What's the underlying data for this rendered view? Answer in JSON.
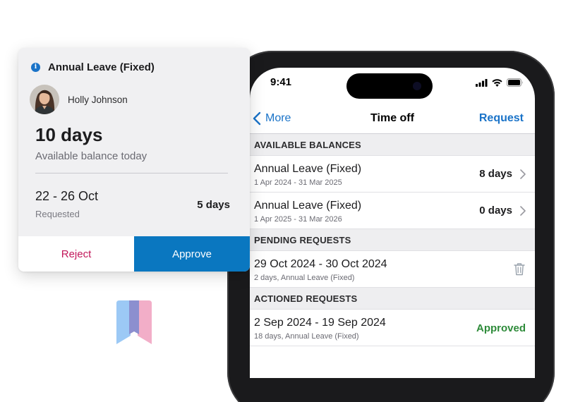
{
  "approval_card": {
    "title": "Annual Leave (Fixed)",
    "employee_name": "Holly Johnson",
    "balance_value": "10 days",
    "balance_label": "Available balance today",
    "request_dates": "22 - 26 Oct",
    "request_label": "Requested",
    "request_days": "5 days",
    "reject_label": "Reject",
    "approve_label": "Approve"
  },
  "phone": {
    "status_time": "9:41",
    "nav": {
      "back_label": "More",
      "title": "Time off",
      "action_label": "Request"
    },
    "sections": {
      "available": {
        "header": "AVAILABLE BALANCES",
        "rows": [
          {
            "title": "Annual Leave (Fixed)",
            "subtitle": "1 Apr 2024 - 31 Mar 2025",
            "value": "8 days"
          },
          {
            "title": "Annual Leave (Fixed)",
            "subtitle": "1 Apr 2025 - 31 Mar 2026",
            "value": "0 days"
          }
        ]
      },
      "pending": {
        "header": "PENDING REQUESTS",
        "rows": [
          {
            "title": "29 Oct 2024 - 30 Oct 2024",
            "subtitle": "2 days, Annual Leave (Fixed)"
          }
        ]
      },
      "actioned": {
        "header": "ACTIONED REQUESTS",
        "rows": [
          {
            "title": "2 Sep 2024 - 19 Sep 2024",
            "subtitle": "18 days, Annual Leave (Fixed)",
            "status": "Approved"
          }
        ]
      }
    }
  },
  "colors": {
    "accent_blue": "#1a73c8",
    "approve_button": "#0a77c0",
    "reject_text": "#c2185b",
    "approved_status": "#2e8b3a"
  }
}
